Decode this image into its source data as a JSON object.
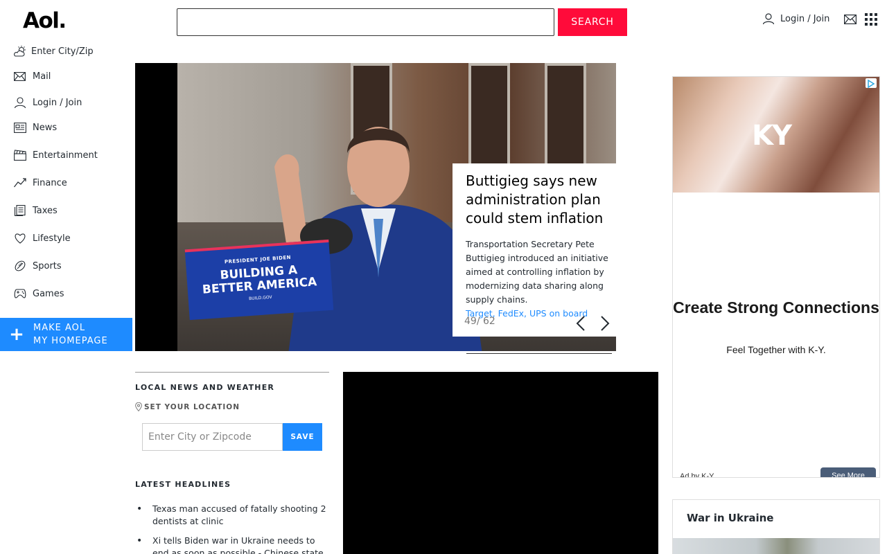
{
  "header": {
    "logo": "Aol.",
    "search_placeholder": "",
    "search_button": "SEARCH",
    "login": "Login / Join"
  },
  "sidebar": {
    "items": [
      {
        "label": "Enter City/Zip",
        "icon": "weather-icon"
      },
      {
        "label": "Mail",
        "icon": "mail-icon"
      },
      {
        "label": "Login / Join",
        "icon": "user-icon"
      },
      {
        "label": "News",
        "icon": "news-icon"
      },
      {
        "label": "Entertainment",
        "icon": "clapper-icon"
      },
      {
        "label": "Finance",
        "icon": "chart-icon"
      },
      {
        "label": "Taxes",
        "icon": "document-icon"
      },
      {
        "label": "Lifestyle",
        "icon": "heart-icon"
      },
      {
        "label": "Sports",
        "icon": "ball-icon"
      },
      {
        "label": "Games",
        "icon": "gamepad-icon"
      }
    ],
    "make_home_line1": "MAKE AOL",
    "make_home_line2": "MY HOMEPAGE"
  },
  "hero": {
    "sign_line1": "PRESIDENT JOE BIDEN",
    "sign_line2": "BUILDING A",
    "sign_line3": "BETTER AMERICA",
    "sign_line4": "BUILD.GOV",
    "title": "Buttigieg says new administration plan could stem inflation",
    "summary": "Transportation Secretary Pete Buttigieg introduced an initiative aimed at controlling inflation by modernizing data sharing along supply chains.",
    "related": "Target, FedEx, UPS on board",
    "counter": "49/ 62"
  },
  "local": {
    "heading": "LOCAL NEWS AND WEATHER",
    "set_location": "SET YOUR LOCATION",
    "zip_placeholder": "Enter City or Zipcode",
    "save": "SAVE"
  },
  "headlines": {
    "heading": "LATEST HEADLINES",
    "items": [
      "Texas man accused of fatally shooting 2 dentists at clinic",
      "Xi tells Biden war in Ukraine needs to end as soon as possible - Chinese state media"
    ]
  },
  "ad": {
    "logo": "KY",
    "title": "Create Strong Connections",
    "subtitle": "Feel Together with K-Y.",
    "by": "Ad by K-Y",
    "more": "See More"
  },
  "ukraine": {
    "title": "War in Ukraine"
  },
  "colors": {
    "search_button": "#ff0b3a",
    "accent_blue": "#1e8bff"
  }
}
